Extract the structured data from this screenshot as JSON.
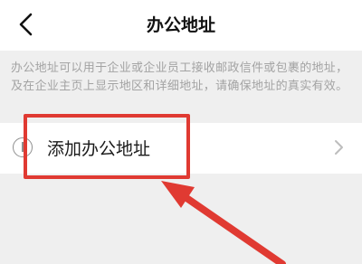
{
  "header": {
    "title": "办公地址",
    "back_icon": "chevron-left-icon"
  },
  "description": "办公地址可以用于企业或企业员工接收邮政信件或包裹的地址，及在企业主页上显示地区和详细地址，请确保地址的真实有效。",
  "add_row": {
    "label": "添加办公地址",
    "leading_icon": "add-circle-icon",
    "trailing_icon": "chevron-right-icon"
  },
  "colors": {
    "annotation": "#e03a32",
    "background": "#efefef",
    "description_text": "#a3a3a3"
  }
}
